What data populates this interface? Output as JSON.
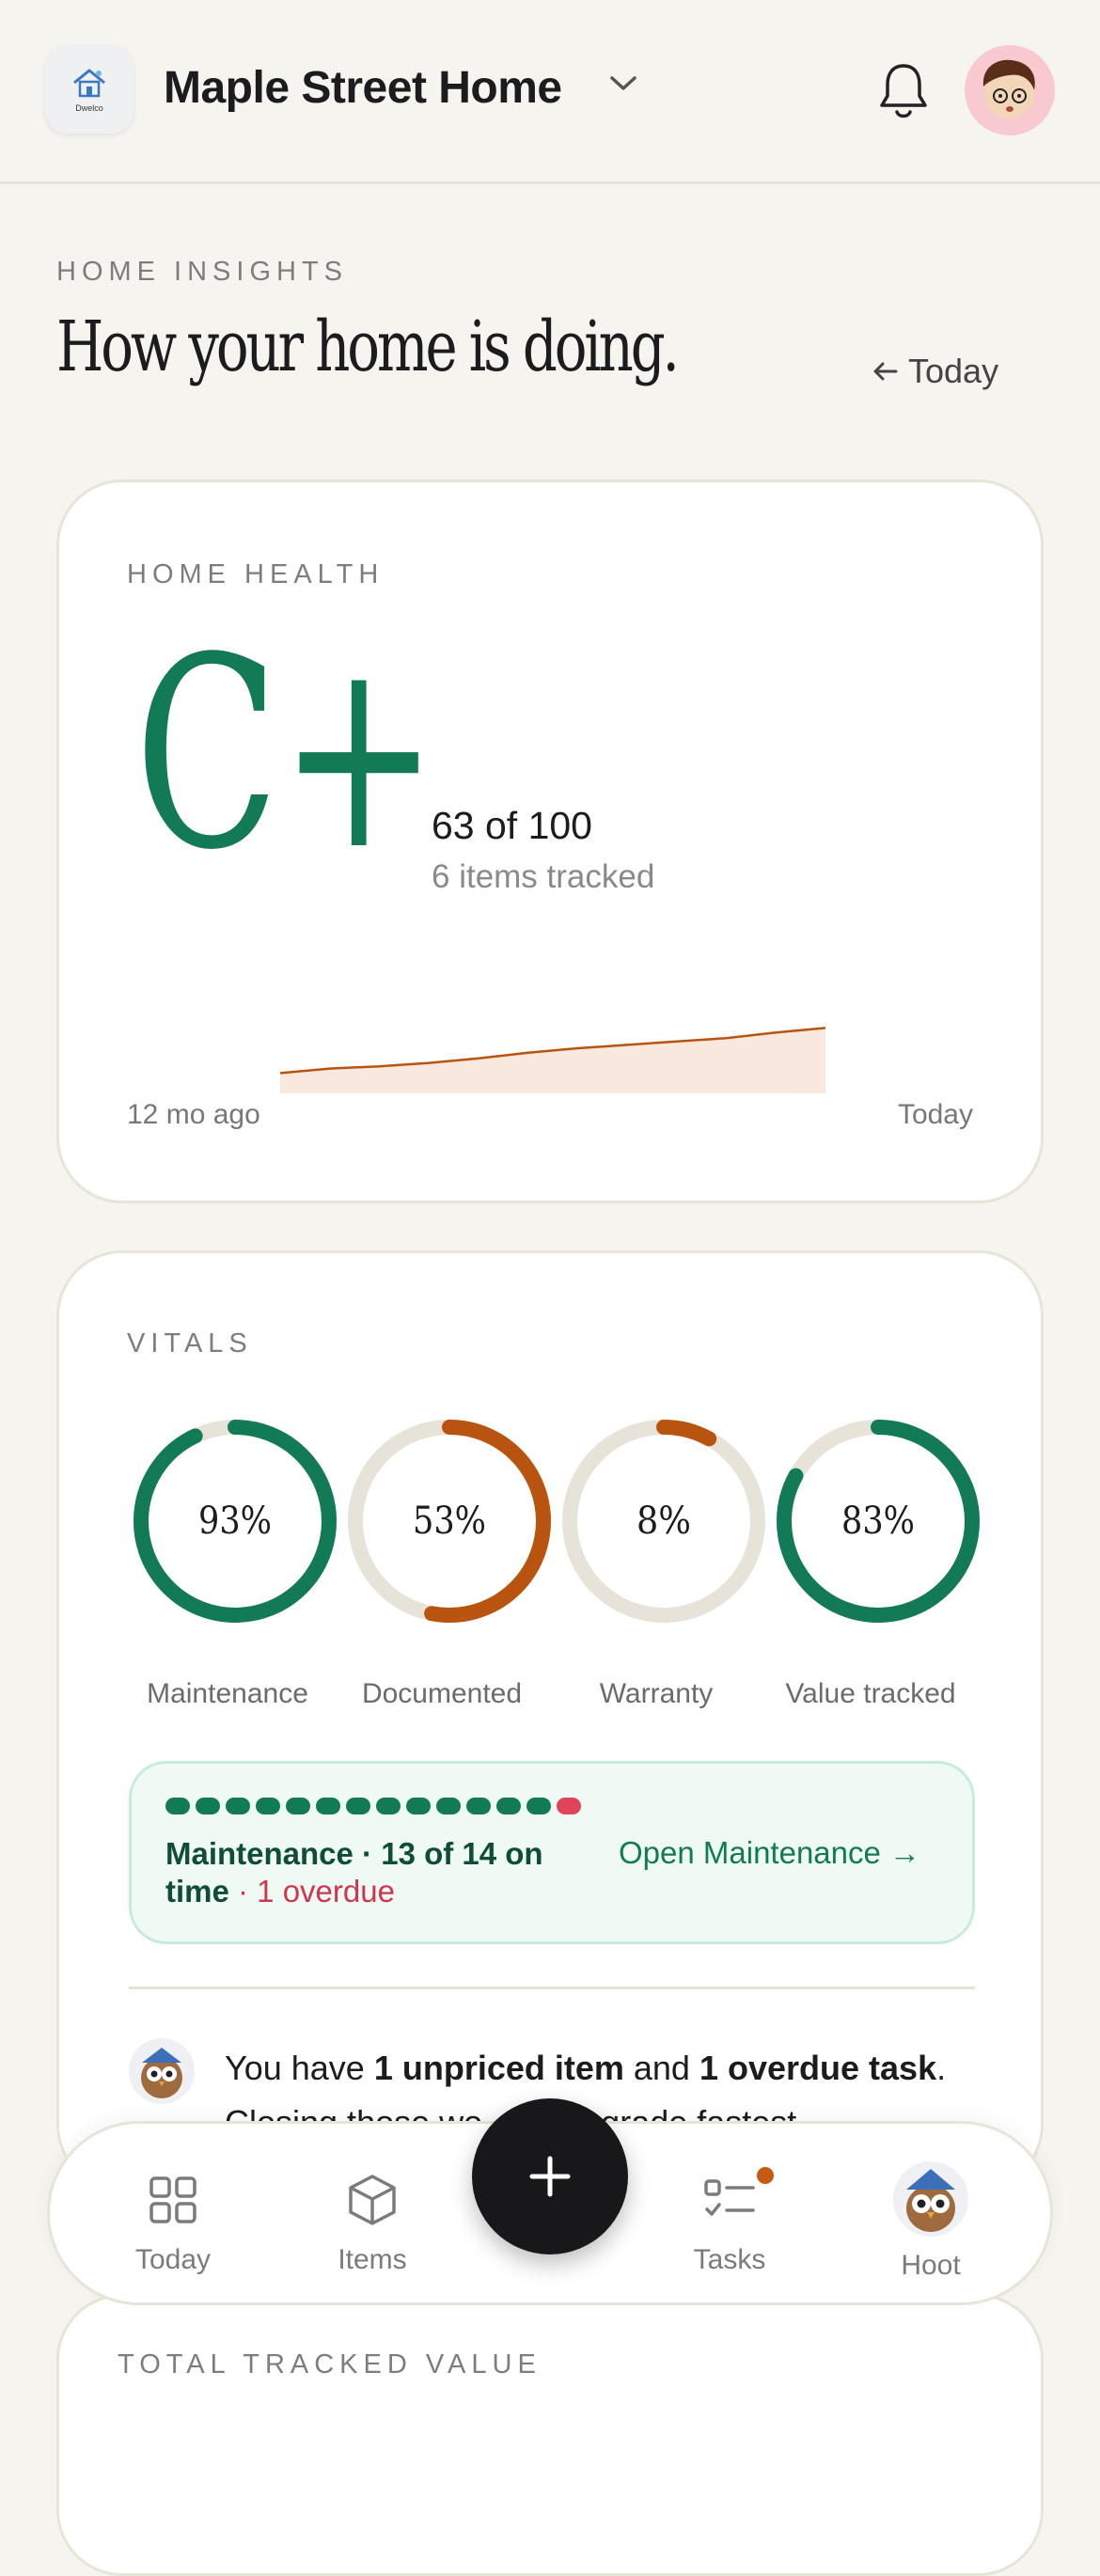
{
  "header": {
    "logo_text": "Dwelco",
    "home_name": "Maple Street Home"
  },
  "page": {
    "eyebrow": "HOME INSIGHTS",
    "title": "How your home is doing.",
    "back_label": "Today"
  },
  "health": {
    "eyebrow": "HOME HEALTH",
    "grade": "C+",
    "score": "63 of 100",
    "items_tracked": "6 items tracked",
    "trend_start_label": "12 mo ago",
    "trend_end_label": "Today",
    "trend_values": [
      18,
      22,
      24,
      27,
      31,
      36,
      40,
      43,
      46,
      49,
      54,
      58
    ],
    "colors": {
      "grade": "#137a56",
      "trend_line": "#b8540f",
      "trend_fill": "#f8e8de"
    }
  },
  "vitals": {
    "eyebrow": "VITALS",
    "rings": [
      {
        "label": "Maintenance",
        "value_text": "93%",
        "value": 0.93,
        "color": "#137a56"
      },
      {
        "label": "Documented",
        "value_text": "53%",
        "value": 0.53,
        "color": "#b8540f"
      },
      {
        "label": "Warranty",
        "value_text": "8%",
        "value": 0.08,
        "color": "#b8540f"
      },
      {
        "label": "Value tracked",
        "value_text": "83%",
        "value": 0.83,
        "color": "#137a56"
      }
    ],
    "maintenance": {
      "on_time": 13,
      "total": 14,
      "summary": "Maintenance · 13 of 14 on time",
      "overdue": " · 1 overdue",
      "link": "Open Maintenance →"
    },
    "insight": {
      "prefix": "You have ",
      "bold1": "1 unpriced item",
      "middle": " and ",
      "bold2": "1 overdue task",
      "suffix": ". Closing those wo… your grade fastest."
    }
  },
  "value_card": {
    "eyebrow": "TOTAL TRACKED VALUE"
  },
  "nav": {
    "items": [
      {
        "label": "Today",
        "icon": "grid-icon"
      },
      {
        "label": "Items",
        "icon": "box-icon"
      },
      {
        "label": "Tasks",
        "icon": "checklist-icon"
      },
      {
        "label": "Hoot",
        "icon": "owl-avatar"
      }
    ],
    "add_icon": "plus-icon",
    "tasks_badge_color": "#c65a12"
  }
}
